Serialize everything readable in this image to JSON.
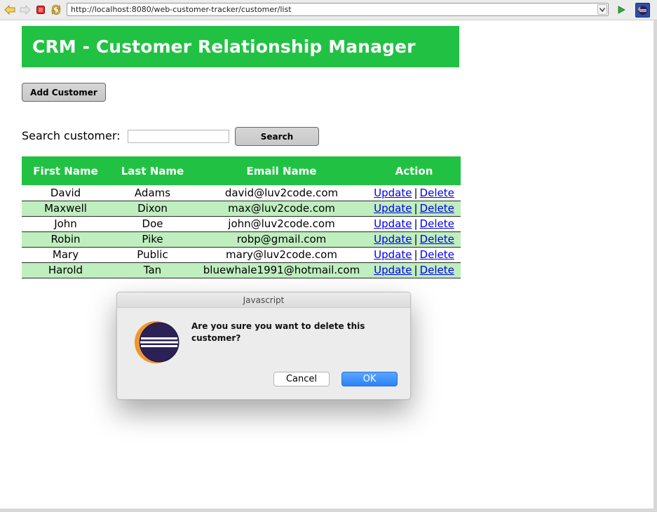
{
  "browser": {
    "url": "http://localhost:8080/web-customer-tracker/customer/list"
  },
  "page": {
    "title": "CRM - Customer Relationship Manager",
    "add_button": "Add Customer",
    "search_label": "Search customer:",
    "search_value": "",
    "search_button": "Search"
  },
  "table": {
    "headers": [
      "First Name",
      "Last Name",
      "Email Name",
      "Action"
    ],
    "update_label": "Update",
    "delete_label": "Delete",
    "separator": "|",
    "rows": [
      {
        "first": "David",
        "last": "Adams",
        "email": "david@luv2code.com"
      },
      {
        "first": "Maxwell",
        "last": "Dixon",
        "email": "max@luv2code.com"
      },
      {
        "first": "John",
        "last": "Doe",
        "email": "john@luv2code.com"
      },
      {
        "first": "Robin",
        "last": "Pike",
        "email": "robp@gmail.com"
      },
      {
        "first": "Mary",
        "last": "Public",
        "email": "mary@luv2code.com"
      },
      {
        "first": "Harold",
        "last": "Tan",
        "email": "bluewhale1991@hotmail.com"
      }
    ]
  },
  "dialog": {
    "title": "Javascript",
    "message": "Are you sure you want to delete this customer?",
    "cancel": "Cancel",
    "ok": "OK",
    "icon": "eclipse-icon"
  },
  "colors": {
    "header_green": "#21c244",
    "row_alt": "#bfeebf",
    "link": "#0000ee",
    "ok_blue": "#2c82f5"
  }
}
